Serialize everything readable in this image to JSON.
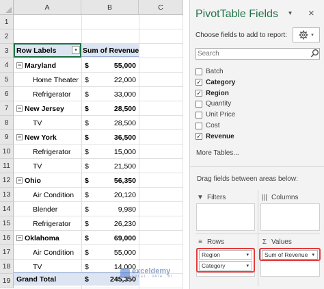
{
  "sheet": {
    "columns": [
      "A",
      "B",
      "C"
    ],
    "rows": [
      "1",
      "2",
      "3",
      "4",
      "5",
      "6",
      "7",
      "8",
      "9",
      "10",
      "11",
      "12",
      "13",
      "14",
      "15",
      "16",
      "17",
      "18",
      "19"
    ],
    "header": {
      "row_labels": "Row Labels",
      "filter_icon": "▾",
      "value_header": "Sum of Revenue"
    },
    "data_rows": [
      {
        "label": "Maryland",
        "currency": "$",
        "value": "55,000"
      },
      {
        "label": "Home Theater",
        "currency": "$",
        "value": "22,000"
      },
      {
        "label": "Refrigerator",
        "currency": "$",
        "value": "33,000"
      },
      {
        "label": "New Jersey",
        "currency": "$",
        "value": "28,500"
      },
      {
        "label": "TV",
        "currency": "$",
        "value": "28,500"
      },
      {
        "label": "New York",
        "currency": "$",
        "value": "36,500"
      },
      {
        "label": "Refrigerator",
        "currency": "$",
        "value": "15,000"
      },
      {
        "label": "TV",
        "currency": "$",
        "value": "21,500"
      },
      {
        "label": "Ohio",
        "currency": "$",
        "value": "56,350"
      },
      {
        "label": "Air Condition",
        "currency": "$",
        "value": "20,120"
      },
      {
        "label": "Blender",
        "currency": "$",
        "value": "9,980"
      },
      {
        "label": "Refrigerator",
        "currency": "$",
        "value": "26,230"
      },
      {
        "label": "Oklahoma",
        "currency": "$",
        "value": "69,000"
      },
      {
        "label": "Air Condition",
        "currency": "$",
        "value": "55,000"
      },
      {
        "label": "TV",
        "currency": "$",
        "value": "14,000"
      }
    ],
    "grand_total": {
      "label": "Grand Total",
      "currency": "$",
      "value": "245,350"
    },
    "collapse_symbol": "−"
  },
  "watermark": {
    "name": "exceldemy",
    "tagline": "EXCEL · DATA · BI"
  },
  "pivot_pane": {
    "title": "PivotTable Fields",
    "caret": "▾",
    "close": "×",
    "choose_text": "Choose fields to add to report:",
    "gear_icon": "gear-icon",
    "search_placeholder": "Search",
    "fields": [
      {
        "label": "Batch",
        "checked": false
      },
      {
        "label": "Category",
        "checked": true
      },
      {
        "label": "Region",
        "checked": true
      },
      {
        "label": "Quantity",
        "checked": false
      },
      {
        "label": "Unit Price",
        "checked": false
      },
      {
        "label": "Cost",
        "checked": false
      },
      {
        "label": "Revenue",
        "checked": true
      }
    ],
    "check_mark": "✓",
    "more_tables": "More Tables...",
    "drag_text": "Drag fields between areas below:",
    "areas": {
      "filters": "Filters",
      "columns": "Columns",
      "rows": "Rows",
      "values": "Values"
    },
    "area_icons": {
      "filters": "▼",
      "columns": "|||",
      "rows": "≡",
      "values": "Σ"
    },
    "rows_fields": [
      "Region",
      "Category"
    ],
    "values_fields": [
      "Sum of Revenue"
    ],
    "chip_caret": "▾"
  },
  "colors": {
    "excel_green": "#217346",
    "pivot_header": "#dde5f2",
    "highlight": "#e33b3b"
  }
}
